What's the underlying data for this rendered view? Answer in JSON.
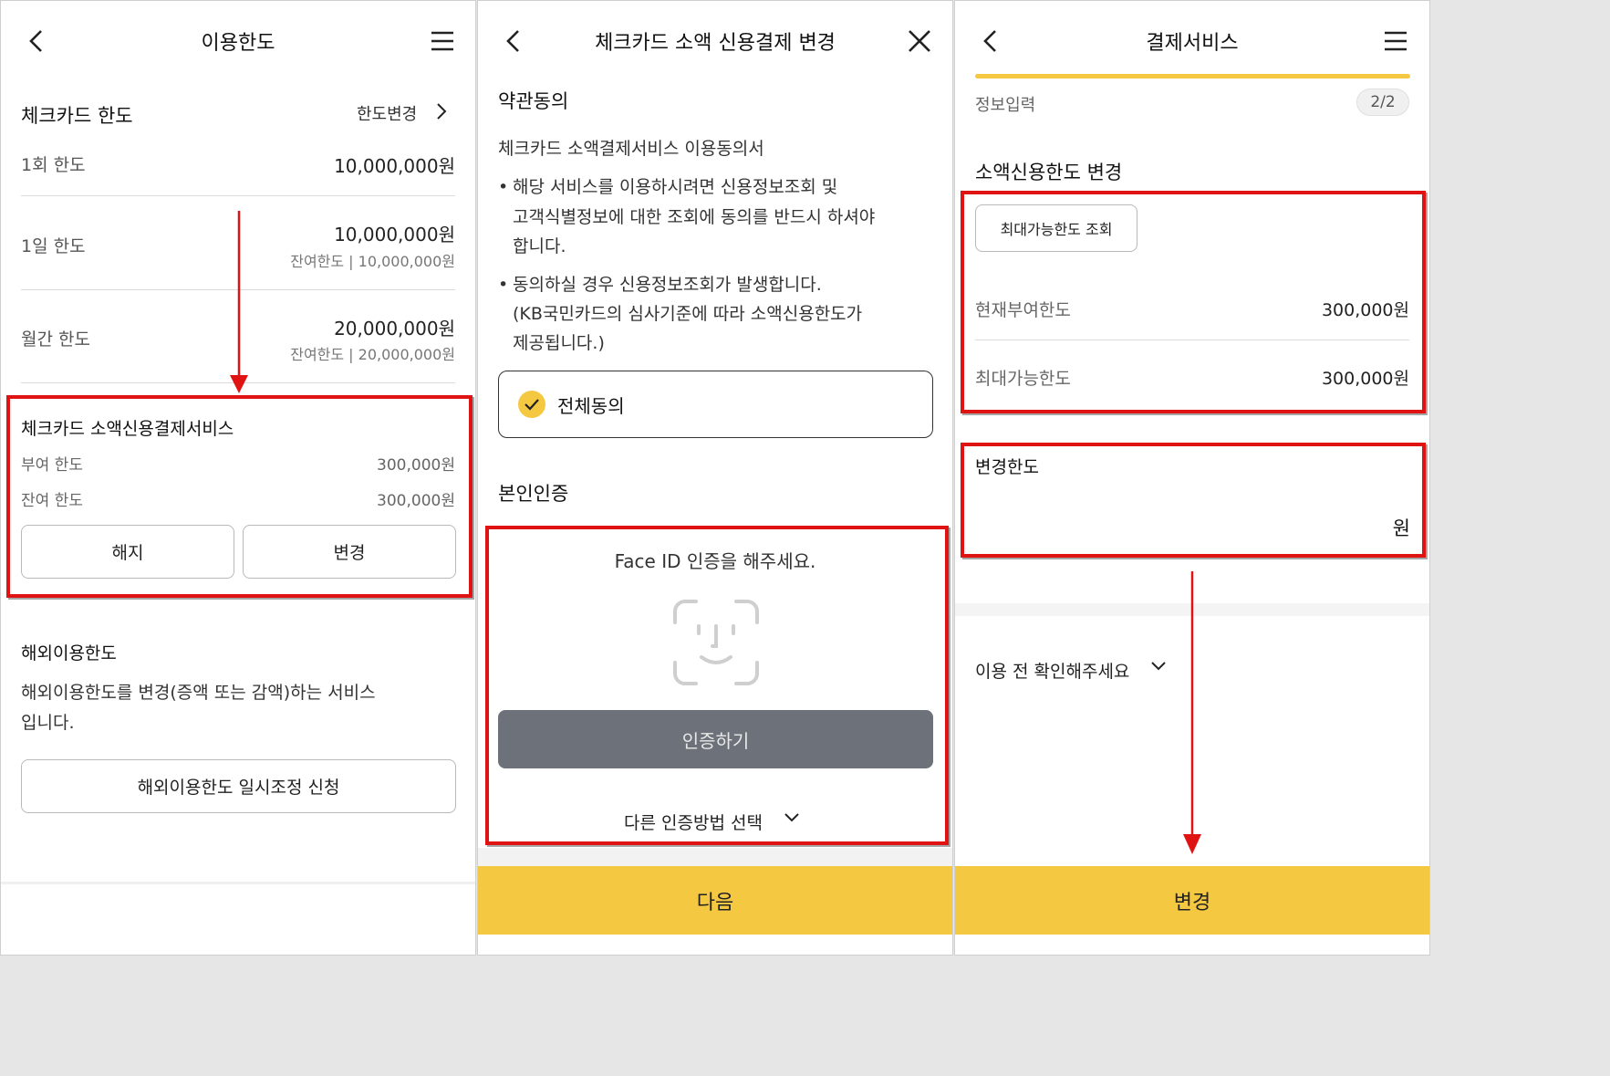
{
  "colors": {
    "accent": "#f5c842",
    "annotation": "#e01313",
    "auth_button": "#6d727a"
  },
  "panel1": {
    "title": "이용한도",
    "check_card_limit": {
      "heading": "체크카드 한도",
      "change_link": "한도변경",
      "per_use_label": "1회 한도",
      "per_use_value": "10,000,000원",
      "daily_label": "1일 한도",
      "daily_value": "10,000,000원",
      "daily_remaining": "잔여한도 | 10,000,000원",
      "monthly_label": "월간 한도",
      "monthly_value": "20,000,000원",
      "monthly_remaining": "잔여한도 | 20,000,000원"
    },
    "small_credit": {
      "heading": "체크카드 소액신용결제서비스",
      "granted_label": "부여 한도",
      "granted_value": "300,000원",
      "remaining_label": "잔여 한도",
      "remaining_value": "300,000원",
      "cancel_button": "해지",
      "change_button": "변경"
    },
    "overseas": {
      "heading": "해외이용한도",
      "desc_line1": "해외이용한도를 변경(증액 또는 감액)하는 서비스",
      "desc_line2": "입니다.",
      "button": "해외이용한도 일시조정 신청"
    }
  },
  "panel2": {
    "title": "체크카드 소액 신용결제 변경",
    "terms_heading": "약관동의",
    "terms_doc": "체크카드 소액결제서비스 이용동의서",
    "bullet1": [
      "해당 서비스를 이용하시려면 신용정보조회 및",
      "고객식별정보에 대한 조회에 동의를 반드시 하셔야",
      "합니다."
    ],
    "bullet2": [
      "동의하실 경우 신용정보조회가 발생합니다.",
      "(KB국민카드의 심사기준에 따라 소액신용한도가",
      "제공됩니다.)"
    ],
    "agree_all": "전체동의",
    "auth_heading": "본인인증",
    "face_id_prompt": "Face ID 인증을 해주세요.",
    "auth_button": "인증하기",
    "other_method": "다른 인증방법 선택",
    "next_button": "다음"
  },
  "panel3": {
    "title": "결제서비스",
    "step_label": "정보입력",
    "step_badge": "2/2",
    "progress": 1.0,
    "section_heading": "소액신용한도 변경",
    "max_query_button": "최대가능한도 조회",
    "current_label": "현재부여한도",
    "current_value": "300,000원",
    "max_label": "최대가능한도",
    "max_value": "300,000원",
    "change_label": "변경한도",
    "input_unit": "원",
    "notice": "이용 전 확인해주세요",
    "submit_button": "변경"
  }
}
